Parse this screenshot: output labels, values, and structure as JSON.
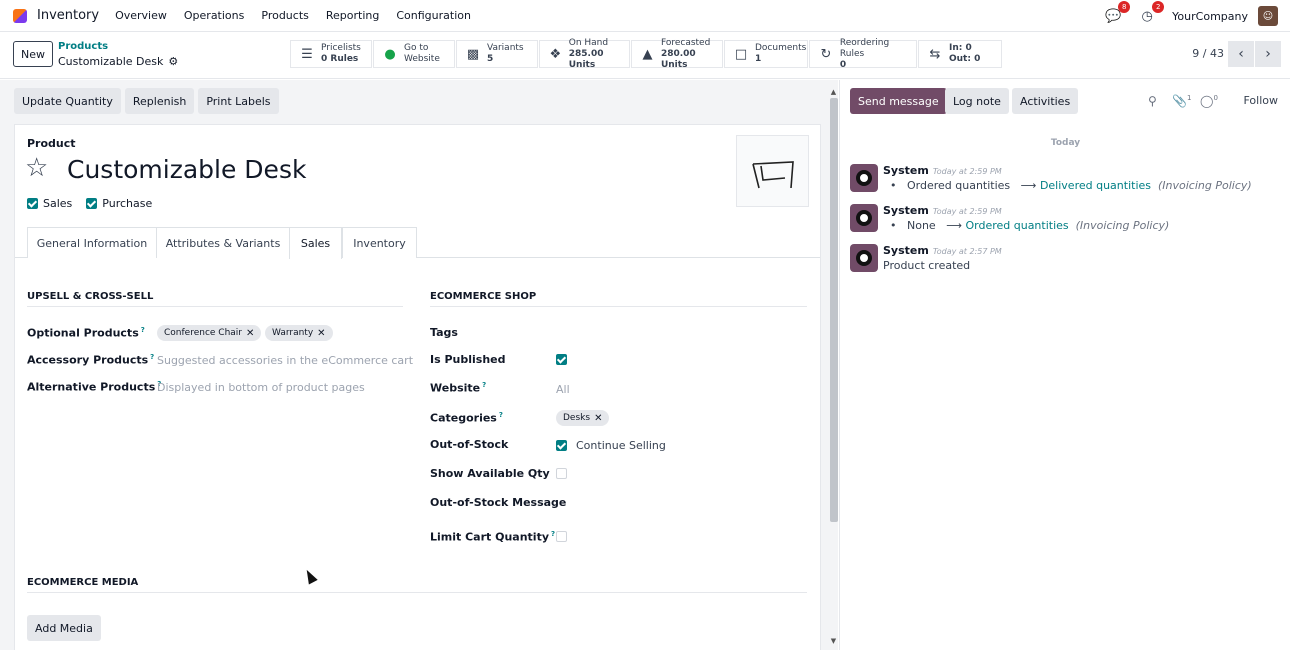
{
  "nav": {
    "app_name": "Inventory",
    "menus": [
      "Overview",
      "Operations",
      "Products",
      "Reporting",
      "Configuration"
    ],
    "messages_badge": "8",
    "activities_badge": "2",
    "company": "YourCompany"
  },
  "control": {
    "new_label": "New",
    "breadcrumb_parent": "Products",
    "breadcrumb_current": "Customizable Desk",
    "smart_buttons": [
      {
        "icon": "list-icon",
        "line1": "Pricelists",
        "line2": "0 Rules"
      },
      {
        "icon": "globe-icon",
        "line1": "Go to",
        "line2": "Website"
      },
      {
        "icon": "sitemap-icon",
        "line1": "Variants",
        "line2": "5"
      },
      {
        "icon": "cubes-icon",
        "line1": "On Hand",
        "line2": "285.00 Units"
      },
      {
        "icon": "area-chart-icon",
        "line1": "Forecasted",
        "line2": "280.00 Units"
      },
      {
        "icon": "document-icon",
        "line1": "Documents",
        "line2": "1"
      },
      {
        "icon": "refresh-icon",
        "line1": "Reordering Rules",
        "line2": "0"
      },
      {
        "icon": "exchange-icon",
        "line1": "In: 0",
        "line2": "Out: 0"
      }
    ],
    "pager": "9 / 43"
  },
  "actions": [
    "Update Quantity",
    "Replenish",
    "Print Labels"
  ],
  "product": {
    "label": "Product",
    "name": "Customizable Desk",
    "sales_label": "Sales",
    "purchase_label": "Purchase"
  },
  "tabs": [
    "General Information",
    "Attributes & Variants",
    "Sales",
    "Inventory"
  ],
  "upsell": {
    "heading": "UPSELL & CROSS-SELL",
    "optional_label": "Optional Products",
    "optional_tags": [
      "Conference Chair",
      "Warranty"
    ],
    "accessory_label": "Accessory Products",
    "accessory_placeholder": "Suggested accessories in the eCommerce cart",
    "alternative_label": "Alternative Products",
    "alternative_placeholder": "Displayed in bottom of product pages"
  },
  "ecommerce": {
    "heading": "ECOMMERCE SHOP",
    "tags_label": "Tags",
    "published_label": "Is Published",
    "website_label": "Website",
    "website_value": "All",
    "categories_label": "Categories",
    "categories_tag": "Desks",
    "oos_label": "Out-of-Stock",
    "oos_value": "Continue Selling",
    "show_qty_label": "Show Available Qty",
    "oos_message_label": "Out-of-Stock Message",
    "limit_cart_label": "Limit Cart Quantity"
  },
  "media": {
    "heading": "ECOMMERCE MEDIA",
    "add_label": "Add Media"
  },
  "chatter": {
    "send_message": "Send message",
    "log_note": "Log note",
    "activities": "Activities",
    "attachments_count": "1",
    "followers_count": "0",
    "follow": "Follow",
    "today": "Today",
    "messages": [
      {
        "author": "System",
        "time": "Today at 2:59 PM",
        "old": "Ordered quantities",
        "new": "Delivered quantities",
        "field": "(Invoicing Policy)"
      },
      {
        "author": "System",
        "time": "Today at 2:59 PM",
        "old": "None",
        "new": "Ordered quantities",
        "field": "(Invoicing Policy)"
      },
      {
        "author": "System",
        "time": "Today at 2:57 PM",
        "text": "Product created"
      }
    ]
  }
}
